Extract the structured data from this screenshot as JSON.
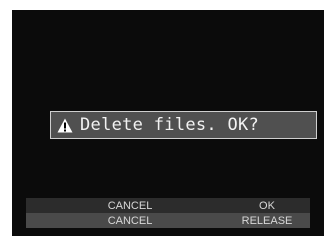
{
  "dialog": {
    "icon": "warning-icon",
    "message": "Delete files. OK?"
  },
  "softkeys": {
    "row1": {
      "left": "CANCEL",
      "right": "OK"
    },
    "row2": {
      "left": "CANCEL",
      "right": "RELEASE"
    }
  },
  "colors": {
    "screen_background": "#0b0b0b",
    "dialog_background": "#505050",
    "dialog_border": "#cfcfcf",
    "softkey_row1_background": "#2c2c2c",
    "softkey_row2_background": "#4a4a4a"
  }
}
